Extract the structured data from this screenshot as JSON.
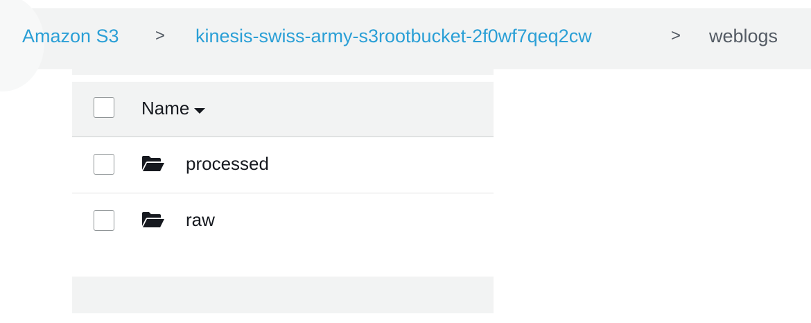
{
  "breadcrumb": {
    "root": "Amazon S3",
    "bucket": "kinesis-swiss-army-s3rootbucket-2f0wf7qeq2cw",
    "current": "weblogs",
    "separator": ">"
  },
  "table": {
    "column_name": "Name",
    "sort_icon": "caret-down-icon",
    "rows": [
      {
        "name": "processed",
        "icon": "folder-open-icon"
      },
      {
        "name": "raw",
        "icon": "folder-open-icon"
      }
    ]
  },
  "colors": {
    "link": "#2a9fd6",
    "text": "#16191f",
    "panel": "#f2f3f3"
  }
}
